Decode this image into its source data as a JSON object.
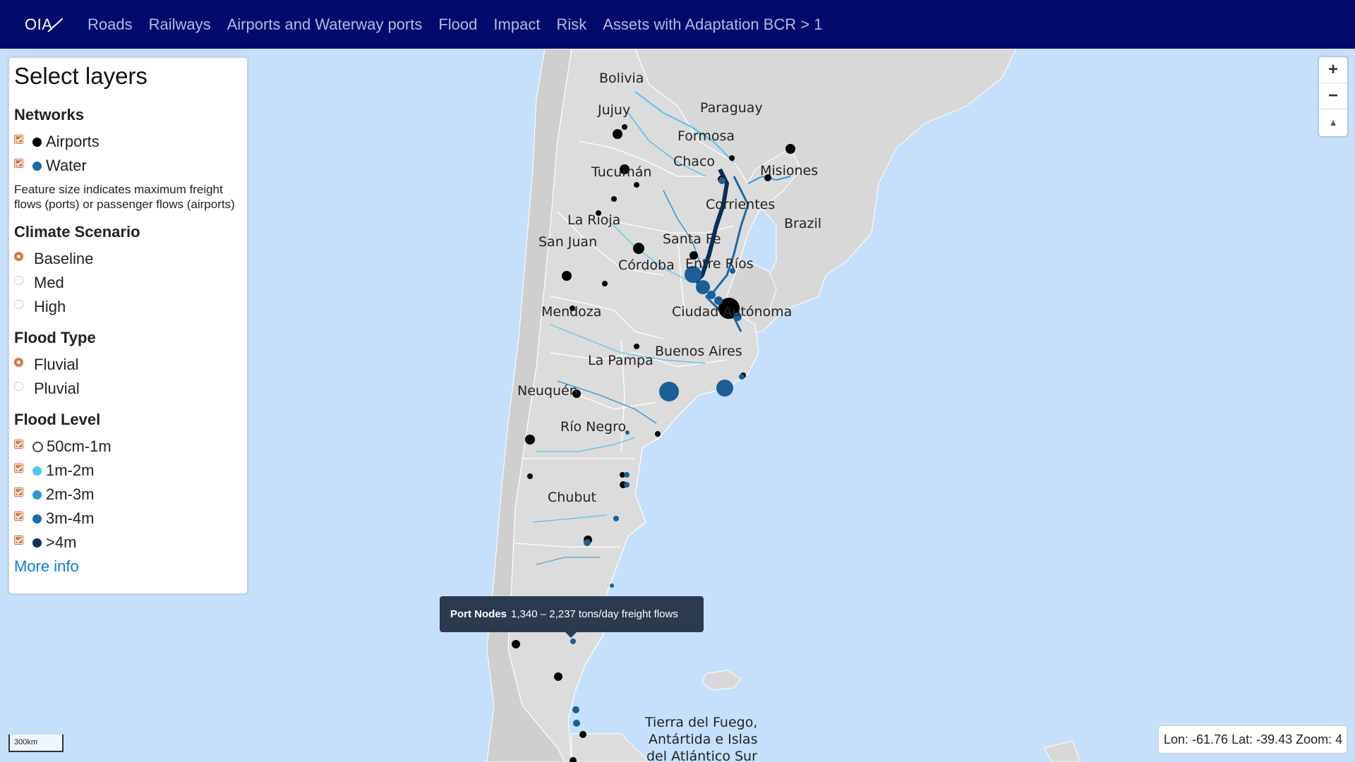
{
  "nav": {
    "brand": "OIA",
    "links": [
      "Roads",
      "Railways",
      "Airports and Waterway ports",
      "Flood",
      "Impact",
      "Risk",
      "Assets with Adaptation BCR > 1"
    ]
  },
  "panel": {
    "title": "Select layers",
    "networks": {
      "heading": "Networks",
      "items": [
        {
          "label": "Airports",
          "checked": true,
          "color": "#000000"
        },
        {
          "label": "Water",
          "checked": true,
          "color": "#1b6aa5"
        }
      ],
      "note": "Feature size indicates maximum freight flows (ports) or passenger flows (airports)"
    },
    "climate": {
      "heading": "Climate Scenario",
      "options": [
        {
          "label": "Baseline",
          "selected": true
        },
        {
          "label": "Med",
          "selected": false
        },
        {
          "label": "High",
          "selected": false
        }
      ]
    },
    "flood_type": {
      "heading": "Flood Type",
      "options": [
        {
          "label": "Fluvial",
          "selected": true
        },
        {
          "label": "Pluvial",
          "selected": false
        }
      ]
    },
    "flood_level": {
      "heading": "Flood Level",
      "items": [
        {
          "label": "50cm-1m",
          "checked": true,
          "color": "ring"
        },
        {
          "label": "1m-2m",
          "checked": true,
          "color": "#4ec5ec"
        },
        {
          "label": "2m-3m",
          "checked": true,
          "color": "#3496d4"
        },
        {
          "label": "3m-4m",
          "checked": true,
          "color": "#1a6aa8"
        },
        {
          "label": ">4m",
          "checked": true,
          "color": "#0b2e5a"
        }
      ]
    },
    "more_info": "More info"
  },
  "map": {
    "labels": [
      "Bolivia",
      "Paraguay",
      "Jujuy",
      "Formosa",
      "Chaco",
      "Misiones",
      "Tucumán",
      "Corrientes",
      "Brazil",
      "La Rioja",
      "Santa Fe",
      "San Juan",
      "Córdoba",
      "Entre Ríos",
      "Mendoza",
      "Ciudad Autónoma",
      "Buenos Aires",
      "La Pampa",
      "Neuquén",
      "Río Negro",
      "Chubut",
      "Tierra del Fuego,",
      "Antártida e Islas",
      "del Atlántico Sur"
    ]
  },
  "zoom": {
    "in": "+",
    "out": "−",
    "reset": "▲"
  },
  "tooltip": {
    "title": "Port Nodes",
    "text": "1,340 – 2,237 tons/day freight flows"
  },
  "coords": "Lon: -61.76 Lat: -39.43 Zoom: 4",
  "scale": "300km"
}
